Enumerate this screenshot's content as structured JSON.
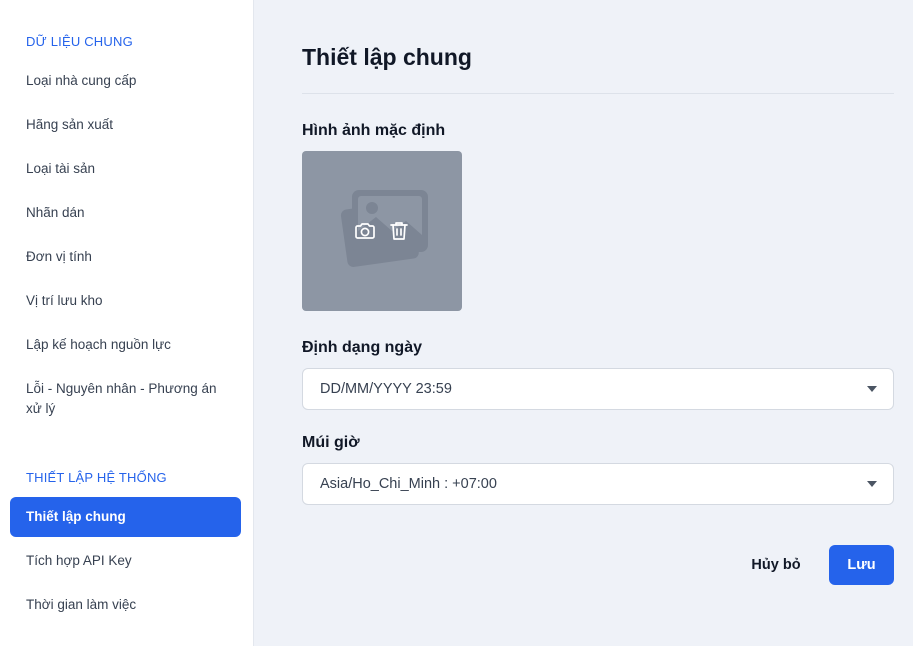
{
  "sidebar": {
    "section_data": "DỮ LIỆU CHUNG",
    "data_items": [
      "Loại nhà cung cấp",
      "Hãng sản xuất",
      "Loại tài sản",
      "Nhãn dán",
      "Đơn vị tính",
      "Vị trí lưu kho",
      "Lập kế hoạch nguồn lực",
      "Lỗi - Nguyên nhân - Phương án xử lý"
    ],
    "section_system": "THIẾT LẬP HỆ THỐNG",
    "system_items": [
      "Thiết lập chung",
      "Tích hợp API Key",
      "Thời gian làm việc"
    ],
    "active_item": "Thiết lập chung"
  },
  "main": {
    "title": "Thiết lập chung",
    "default_image": {
      "label": "Hình ảnh mặc định",
      "icons": [
        "image-placeholder-icon",
        "camera-icon",
        "trash-icon"
      ]
    },
    "date_format": {
      "label": "Định dạng ngày",
      "value": "DD/MM/YYYY 23:59"
    },
    "timezone": {
      "label": "Múi giờ",
      "value": "Asia/Ho_Chi_Minh : +07:00"
    },
    "actions": {
      "cancel_label": "Hủy bỏ",
      "save_label": "Lưu"
    }
  },
  "colors": {
    "accent": "#2563eb",
    "background": "#eff2f8",
    "image_placeholder": "#8d96a4"
  }
}
